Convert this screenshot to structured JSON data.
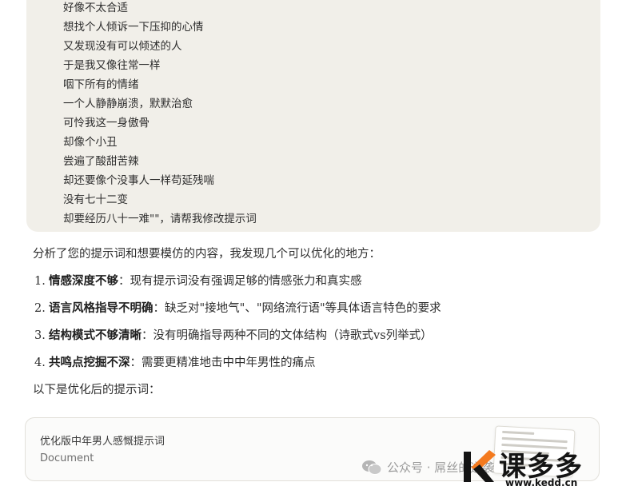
{
  "user_message": {
    "lines": [
      "好像不太合适",
      "想找个人倾诉一下压抑的心情",
      "又发现没有可以倾述的人",
      "于是我又像往常一样",
      "咽下所有的情绪",
      "一个人静静崩溃，默默治愈",
      "可怜我这一身傲骨",
      "却像个小丑",
      "尝遍了酸甜苦辣",
      "却还要像个没事人一样苟延残喘",
      "没有七十二变",
      "却要经历八十一难\"\"，请帮我修改提示词"
    ]
  },
  "reply": {
    "intro": "分析了您的提示词和想要模仿的内容，我发现几个可以优化的地方：",
    "points": [
      {
        "num": "1.",
        "term": "情感深度不够",
        "text": "：现有提示词没有强调足够的情感张力和真实感"
      },
      {
        "num": "2.",
        "term": "语言风格指导不明确",
        "text": "：缺乏对\"接地气\"、\"网络流行语\"等具体语言特色的要求"
      },
      {
        "num": "3.",
        "term": "结构模式不够清晰",
        "text": "：没有明确指导两种不同的文体结构（诗歌式vs列举式）"
      },
      {
        "num": "4.",
        "term": "共鸣点挖掘不深",
        "text": "：需要更精准地击中中年男性的痛点"
      }
    ],
    "outro": "以下是优化后的提示词："
  },
  "artifact": {
    "title": "优化版中年男人感慨提示词",
    "type": "Document"
  },
  "watermark": {
    "text": "公众号 · 屌丝的逆袭",
    "icon": "wechat-icon"
  },
  "logo": {
    "name": "课多多",
    "url": "www.kedd.cn",
    "accent": "#f47a1f"
  }
}
